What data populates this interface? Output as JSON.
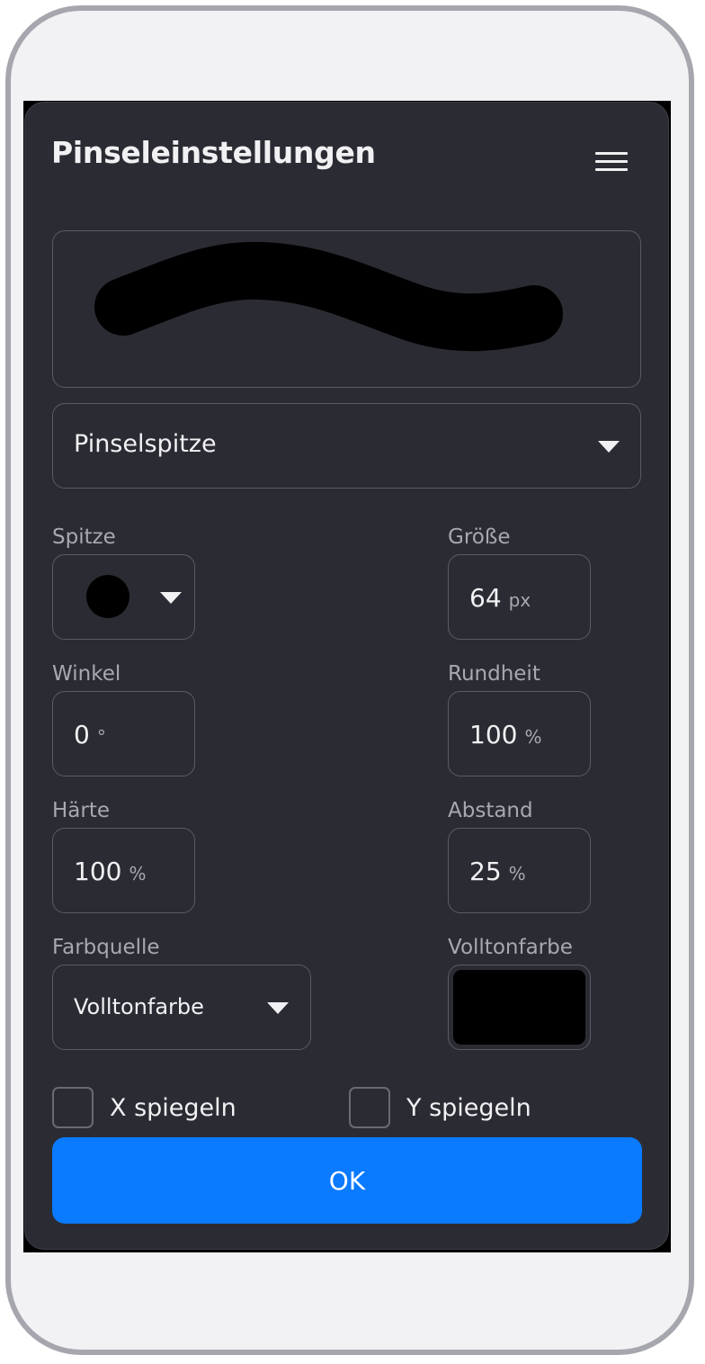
{
  "dialog": {
    "title": "Pinseleinstellungen",
    "menu_icon": "hamburger-menu-icon"
  },
  "preview": {
    "stroke_color": "#000000"
  },
  "brush_tip_select": {
    "label": "Pinselspitze"
  },
  "fields": {
    "tip": {
      "label": "Spitze",
      "shape": "round"
    },
    "size": {
      "label": "Größe",
      "value": "64",
      "unit": "px"
    },
    "angle": {
      "label": "Winkel",
      "value": "0",
      "unit": "°"
    },
    "roundness": {
      "label": "Rundheit",
      "value": "100",
      "unit": "%"
    },
    "hardness": {
      "label": "Härte",
      "value": "100",
      "unit": "%"
    },
    "spacing": {
      "label": "Abstand",
      "value": "25",
      "unit": "%"
    },
    "color_source": {
      "label": "Farbquelle",
      "value": "Volltonfarbe"
    },
    "solid_color": {
      "label": "Volltonfarbe",
      "color": "#000000"
    }
  },
  "checkboxes": {
    "flip_x": {
      "label": "X spiegeln",
      "checked": false
    },
    "flip_y": {
      "label": "Y spiegeln",
      "checked": false
    }
  },
  "ok_button": {
    "label": "OK",
    "color": "#0a7aff"
  },
  "colors": {
    "dialog_bg": "#2b2c33",
    "border": "#5b5c63",
    "text": "#f1f1f3",
    "muted_text": "#a8a9b0",
    "accent": "#0a7aff"
  }
}
